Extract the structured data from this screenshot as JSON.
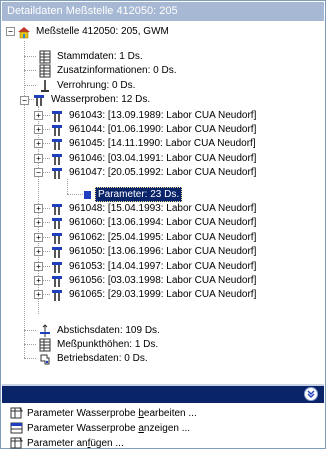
{
  "window": {
    "title": "Detaildaten Meßstelle 412050: 205"
  },
  "tree": {
    "root": {
      "label": "Meßstelle 412050: 205, GWM"
    },
    "children": [
      {
        "label": "Stammdaten: 1 Ds.",
        "icon": "table-icon"
      },
      {
        "label": "Zusatzinformationen: 0 Ds.",
        "icon": "table-icon"
      },
      {
        "label": "Verrohrung: 0 Ds.",
        "icon": "pipe-icon"
      },
      {
        "label": "Wasserproben: 12 Ds.",
        "icon": "sample-icon"
      }
    ],
    "samples": [
      "961043: [13.09.1989: Labor CUA Neudorf]",
      "961044: [01.06.1990: Labor CUA Neudorf]",
      "961045: [14.11.1990: Labor CUA Neudorf]",
      "961046: [03.04.1991: Labor CUA Neudorf]",
      "961047: [20.05.1992: Labor CUA Neudorf]",
      "961048: [15.04.1993: Labor CUA Neudorf]",
      "961060: [13.06.1994: Labor CUA Neudorf]",
      "961062: [25.04.1995: Labor CUA Neudorf]",
      "961050: [13.06.1996: Labor CUA Neudorf]",
      "961053: [14.04.1997: Labor CUA Neudorf]",
      "961056: [03.03.1998: Labor CUA Neudorf]",
      "961065: [29.03.1999: Labor CUA Neudorf]"
    ],
    "selected_child": {
      "label": "Parameter: 23 Ds."
    },
    "tail": [
      {
        "label": "Abstichsdaten: 109 Ds.",
        "icon": "level-icon"
      },
      {
        "label": "Meßpunkthöhen: 1 Ds.",
        "icon": "table-icon"
      },
      {
        "label": "Betriebsdaten: 0 Ds.",
        "icon": "pump-icon"
      }
    ]
  },
  "tasks": [
    {
      "pre": "Parameter Wasserprobe ",
      "key": "b",
      "post": "earbeiten ..."
    },
    {
      "pre": "Parameter Wasserprobe ",
      "key": "a",
      "post": "nzeigen ..."
    },
    {
      "pre": "Parameter an",
      "key": "f",
      "post": "ügen ..."
    }
  ],
  "colors": {
    "selection": "#0a246a",
    "title_bg": "#a6b8d4",
    "icon_blue": "#1f3fbf"
  }
}
